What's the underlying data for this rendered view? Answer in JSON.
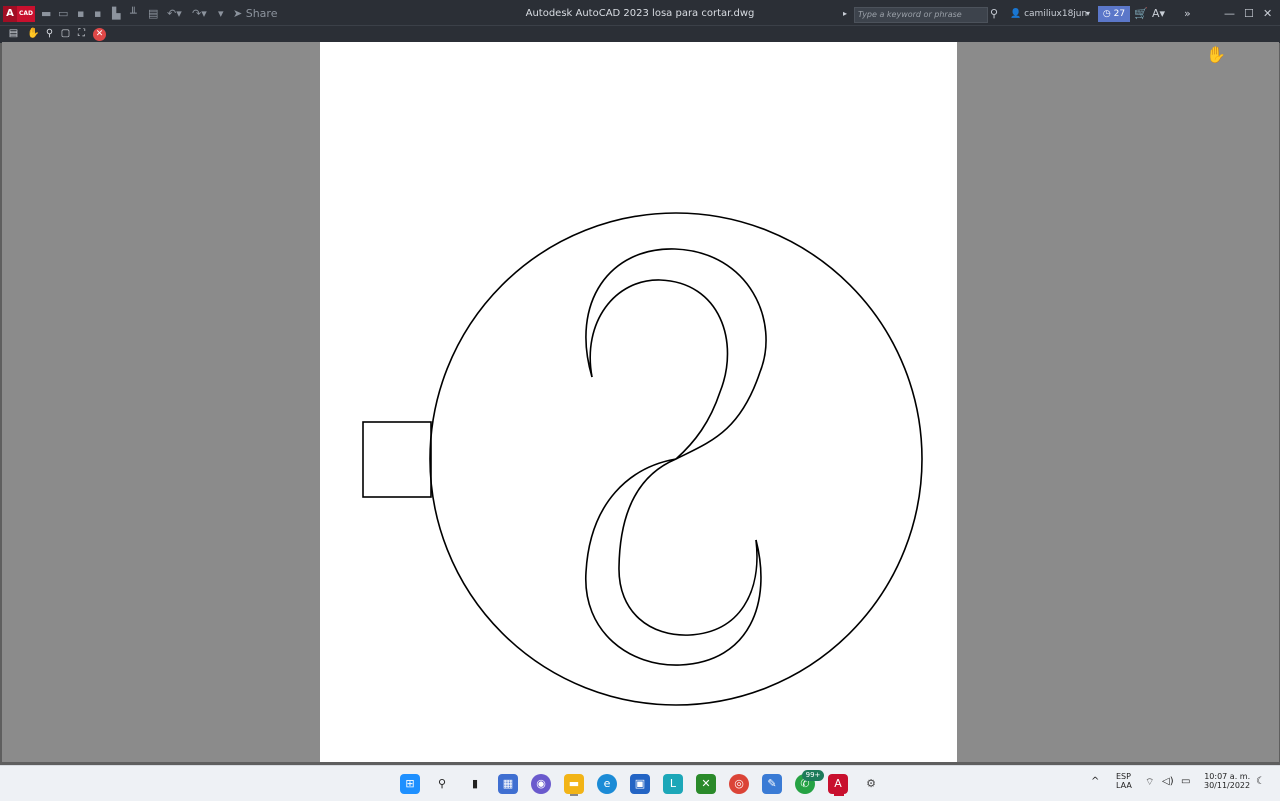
{
  "window": {
    "title": "Autodesk AutoCAD 2023   losa para cortar.dwg",
    "logo_letter": "A",
    "logo_sub": "CAD",
    "share_label": "Share"
  },
  "search": {
    "placeholder": "Type a keyword or phrase"
  },
  "user": {
    "name": "camiliux18jun"
  },
  "timer": {
    "label": "27"
  },
  "toolbar": {
    "tools": [
      "print-icon",
      "pan-hand-icon",
      "zoom-icon",
      "zoom-window-icon",
      "zoom-extents-icon",
      "close-preview-icon"
    ]
  },
  "taskbar": {
    "language": "ESP",
    "language_sub": "LAA",
    "time": "10:07 a. m.",
    "date": "30/11/2022",
    "whatsapp_badge": "99+",
    "apps": [
      "start-icon",
      "search-icon",
      "taskview-icon",
      "widgets-icon",
      "chat-icon",
      "file-explorer-icon",
      "edge-icon",
      "store-icon",
      "l-app-icon",
      "xbox-icon",
      "chrome-icon",
      "paint-icon",
      "whatsapp-icon",
      "autocad-icon",
      "settings-icon"
    ]
  },
  "colors": {
    "titlebar": "#2b2f36",
    "viewport_bg": "#8b8b8b",
    "sheet": "#ffffff",
    "accent": "#5b77c9"
  }
}
